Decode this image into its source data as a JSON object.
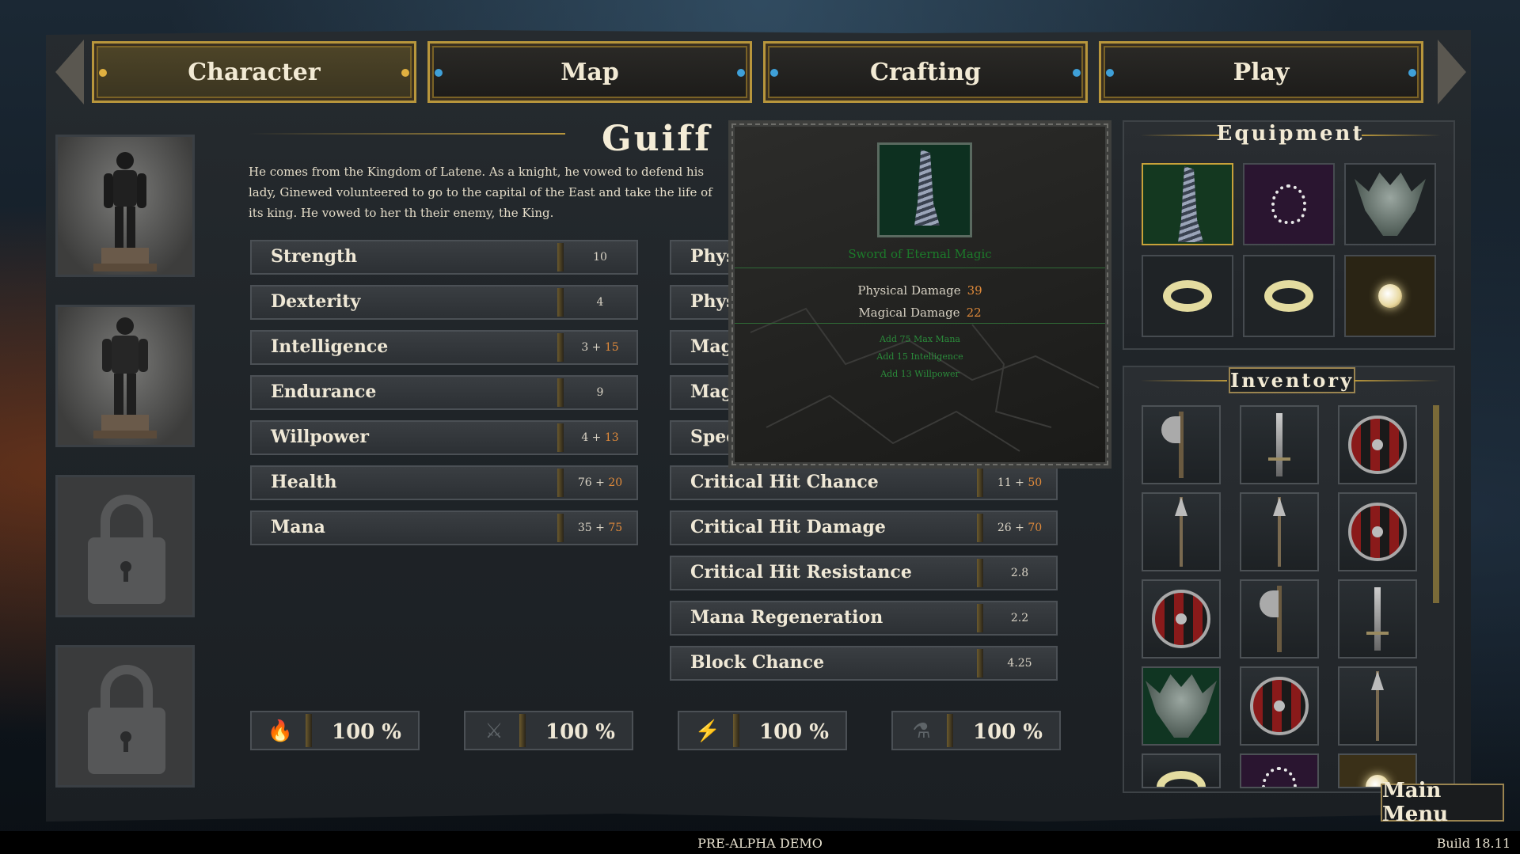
{
  "tabs": [
    {
      "label": "Character",
      "active": true
    },
    {
      "label": "Map",
      "active": false
    },
    {
      "label": "Crafting",
      "active": false
    },
    {
      "label": "Play",
      "active": false
    }
  ],
  "character": {
    "name": "Guiff",
    "bio": "He comes from the Kingdom of Latene. As a knight, he vowed to defend his lady, Ginewed volunteered to go to the capital of the East and take the life of its king. He vowed to her th their enemy, the King."
  },
  "portraits": [
    {
      "state": "unlocked",
      "icon": "knight-portrait"
    },
    {
      "state": "unlocked",
      "icon": "rogue-portrait"
    },
    {
      "state": "locked",
      "icon": "lock-icon"
    },
    {
      "state": "locked",
      "icon": "lock-icon"
    }
  ],
  "stats_left": [
    {
      "label": "Strength",
      "base": "10",
      "bonus": ""
    },
    {
      "label": "Dexterity",
      "base": "4",
      "bonus": ""
    },
    {
      "label": "Intelligence",
      "base": "3 +",
      "bonus": "15"
    },
    {
      "label": "Endurance",
      "base": "9",
      "bonus": ""
    },
    {
      "label": "Willpower",
      "base": "4 +",
      "bonus": "13"
    },
    {
      "label": "Health",
      "base": "76 +",
      "bonus": "20"
    },
    {
      "label": "Mana",
      "base": "35 +",
      "bonus": "75"
    }
  ],
  "stats_right": [
    {
      "label": "Phys",
      "base": "",
      "bonus": ""
    },
    {
      "label": "Phys",
      "base": "",
      "bonus": ""
    },
    {
      "label": "Magi",
      "base": "",
      "bonus": ""
    },
    {
      "label": "Magi",
      "base": "",
      "bonus": ""
    },
    {
      "label": "Spee",
      "base": "",
      "bonus": ""
    },
    {
      "label": "Critical Hit Chance",
      "base": "11 +",
      "bonus": "50"
    },
    {
      "label": "Critical Hit Damage",
      "base": "26 +",
      "bonus": "70"
    },
    {
      "label": "Critical Hit Resistance",
      "base": "2.8",
      "bonus": ""
    },
    {
      "label": "Mana Regeneration",
      "base": "2.2",
      "bonus": ""
    },
    {
      "label": "Block Chance",
      "base": "4.25",
      "bonus": ""
    }
  ],
  "resistances": [
    {
      "icon": "fire-icon",
      "glyph": "🔥",
      "value": "100 %"
    },
    {
      "icon": "claw-icon",
      "glyph": "⚔",
      "value": "100 %"
    },
    {
      "icon": "lightning-icon",
      "glyph": "⚡",
      "value": "100 %"
    },
    {
      "icon": "potion-icon",
      "glyph": "⚗",
      "value": "100 %"
    }
  ],
  "tooltip": {
    "item_name": "Sword of Eternal Magic",
    "physical_label": "Physical Damage",
    "physical_value": "39",
    "magical_label": "Magical Damage",
    "magical_value": "22",
    "effects": [
      "Add 75 Max Mana",
      "Add 15 Intelligence",
      "Add 13 Willpower"
    ]
  },
  "equipment": {
    "title": "Equipment",
    "slots": [
      {
        "item": "sword-icon",
        "style": "sel"
      },
      {
        "item": "necklace-icon",
        "style": "purple"
      },
      {
        "item": "helmet-icon",
        "style": ""
      },
      {
        "item": "ring-icon",
        "style": ""
      },
      {
        "item": "ring-icon",
        "style": ""
      },
      {
        "item": "orb-icon",
        "style": "gold"
      }
    ]
  },
  "inventory": {
    "title": "Inventory",
    "items": [
      "axe-icon",
      "sword-icon",
      "shield-icon",
      "spear-icon",
      "spear-icon",
      "shield-icon",
      "shield-icon",
      "axe-icon",
      "sword-icon",
      "helmet-icon",
      "shield-icon",
      "spear-icon",
      "ring-icon",
      "necklace-icon",
      "orb-icon"
    ]
  },
  "footer": {
    "main_menu": "Main Menu",
    "center_text": "PRE-ALPHA DEMO",
    "build": "Build 18.11"
  },
  "colors": {
    "gold_border": "#b8963c",
    "bonus_orange": "#e08a3a",
    "item_green": "#1c7a2a"
  }
}
